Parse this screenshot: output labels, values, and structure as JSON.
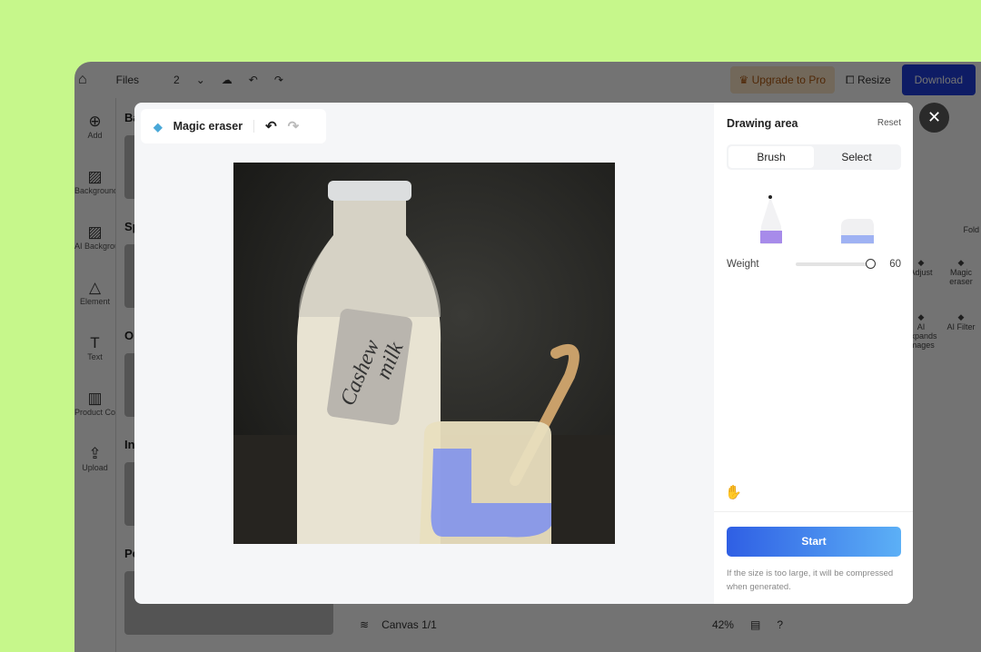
{
  "topbar": {
    "files": "Files",
    "pages": "2",
    "upgrade": "Upgrade to Pro",
    "resize": "Resize",
    "download": "Download"
  },
  "sidebar": {
    "items": [
      {
        "label": "Add",
        "icon": "⊕"
      },
      {
        "label": "Background",
        "icon": "▨"
      },
      {
        "label": "AI Background",
        "icon": "▨"
      },
      {
        "label": "Element",
        "icon": "△"
      },
      {
        "label": "Text",
        "icon": "T"
      },
      {
        "label": "Product Collage",
        "icon": "▥"
      },
      {
        "label": "Upload",
        "icon": "⇪"
      }
    ]
  },
  "panel2": {
    "sections": [
      "Ba",
      "Sp",
      "O",
      "In",
      "Pe"
    ]
  },
  "right_tools": {
    "fold": "Fold",
    "items": [
      "Adjust",
      "Magic eraser",
      "AI Expands Images",
      "AI Filter"
    ]
  },
  "bottom": {
    "canvas": "Canvas 1/1",
    "zoom": "42%",
    "help": "?"
  },
  "modal": {
    "tool_title": "Magic eraser",
    "photo_tag": [
      "Cashew",
      "milk"
    ],
    "panel": {
      "title": "Drawing area",
      "reset": "Reset",
      "tabs": [
        "Brush",
        "Select"
      ],
      "active_tab": "Brush",
      "weight_label": "Weight",
      "weight_value": "60",
      "weight_fraction": 0.95,
      "start": "Start",
      "note": "If the size is too large, it will be compressed when generated.",
      "brush_color": "#a78bea",
      "eraser_color": "#9fb2f3"
    }
  }
}
